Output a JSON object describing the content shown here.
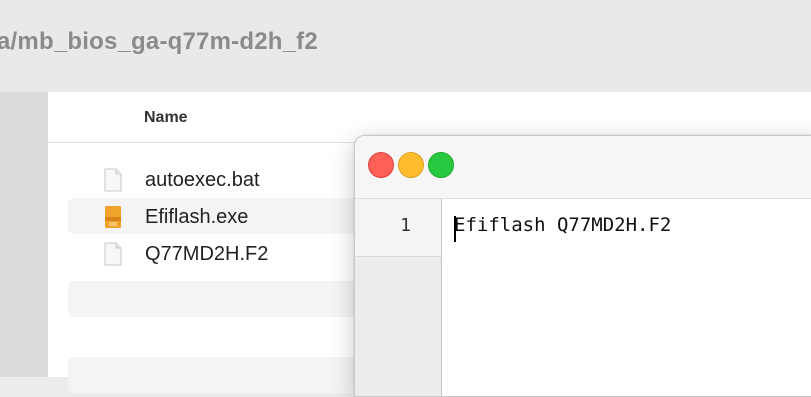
{
  "finder": {
    "path_title": "a/mb_bios_ga-q77m-d2h_f2",
    "column_name": "Name",
    "files": [
      {
        "name": "autoexec.bat",
        "icon": "document-icon"
      },
      {
        "name": "Efiflash.exe",
        "icon": "executable-icon"
      },
      {
        "name": "Q77MD2H.F2",
        "icon": "document-icon"
      }
    ]
  },
  "editor": {
    "line_numbers": [
      "1"
    ],
    "lines": [
      "Efiflash Q77MD2H.F2"
    ]
  },
  "colors": {
    "close": "#fe5f57",
    "minimize": "#febc2e",
    "zoom": "#28c840",
    "exe_icon": "#f0a32a"
  }
}
